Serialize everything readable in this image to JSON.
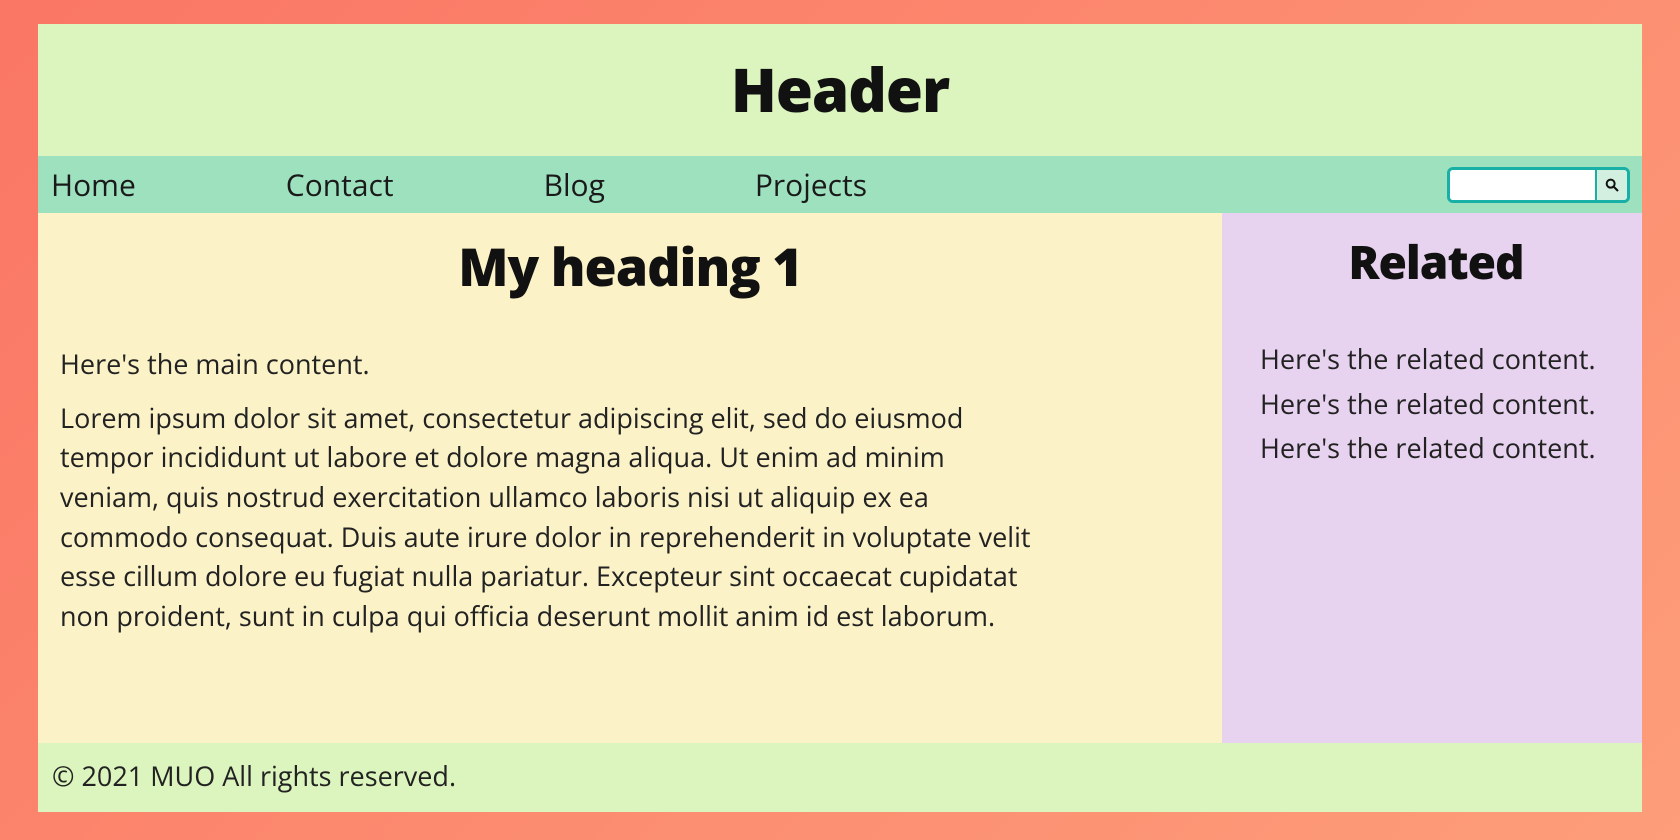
{
  "header": {
    "title": "Header"
  },
  "nav": {
    "items": [
      {
        "label": "Home"
      },
      {
        "label": "Contact"
      },
      {
        "label": "Blog"
      },
      {
        "label": "Projects"
      }
    ],
    "search": {
      "value": ""
    }
  },
  "main": {
    "heading": "My heading 1",
    "intro": "Here's the main content.",
    "body": "Lorem ipsum dolor sit amet, consectetur adipiscing elit, sed do eiusmod tempor incididunt ut labore et dolore magna aliqua. Ut enim ad minim veniam, quis nostrud exercitation ullamco laboris nisi ut aliquip ex ea commodo consequat. Duis aute irure dolor in reprehenderit in voluptate velit esse cillum dolore eu fugiat nulla pariatur. Excepteur sint occaecat cupidatat non proident, sunt in culpa qui officia deserunt mollit anim id est laborum."
  },
  "sidebar": {
    "heading": "Related",
    "items": [
      "Here's the related content.",
      "Here's the related content.",
      "Here's the related content."
    ]
  },
  "footer": {
    "text": "© 2021 MUO All rights reserved."
  }
}
